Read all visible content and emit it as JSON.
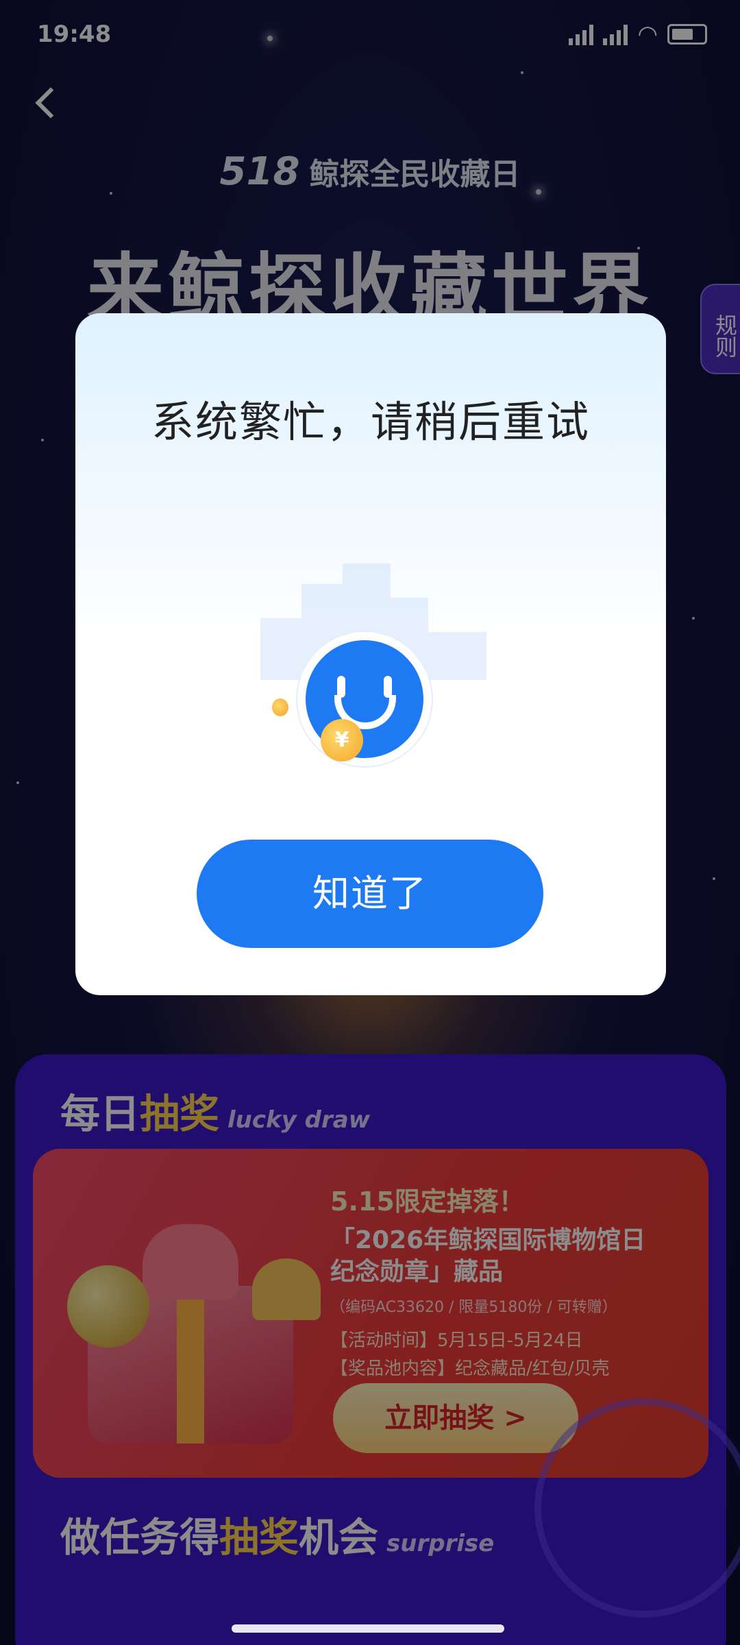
{
  "status_bar": {
    "time": "19:48"
  },
  "header": {
    "logo_number": "518",
    "logo_text": "鲸探全民收藏日",
    "hero_title": "来鲸探收藏世界",
    "rules_label": "规则"
  },
  "lucky_draw": {
    "title_a": "每日",
    "title_b": "抽奖",
    "subtitle": "lucky draw",
    "line1": "5.15限定掉落！",
    "line2": "「2026年鲸探国际博物馆日纪念勋章」藏品",
    "line3": "（编码AC33620 / 限量5180份 / 可转赠）",
    "line4": "【活动时间】5月15日-5月24日",
    "line5": "【奖品池内容】纪念藏品/红包/贝壳",
    "button": "立即抽奖 >"
  },
  "tasks": {
    "title_a": "做任务得",
    "title_b": "抽奖",
    "title_c": "机会",
    "subtitle": "surprise"
  },
  "dialog": {
    "title": "系统繁忙，请稍后重试",
    "coin_symbol": "¥",
    "button": "知道了"
  },
  "colors": {
    "accent": "#1d7af2",
    "panel": "#3c19c9",
    "card": "#ef3b3b"
  }
}
